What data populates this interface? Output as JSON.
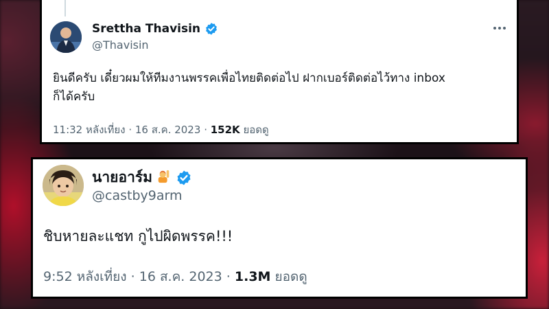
{
  "tweets": [
    {
      "name": "Srettha Thavisin",
      "handle": "@Thavisin",
      "verified": true,
      "text_line1": "ยินดีครับ เดี๋ยวผมให้ทีมงานพรรคเพื่อไทยติดต่อไป ฝากเบอร์ติดต่อไว้ทาง inbox",
      "text_line2": "ก็ได้ครับ",
      "time": "11:32 หลังเที่ยง",
      "date": "16 ส.ค. 2023",
      "views": "152K",
      "views_label": "ยอดดู",
      "separator": "·",
      "icons": {
        "verified": "verified-badge-icon",
        "more": "more-options-icon"
      }
    },
    {
      "name": "นายอาร์ม",
      "emoji": "🙋",
      "handle": "@castby9arm",
      "verified": true,
      "text": "ชิบหายละแชท กูไปผิดพรรค!!!",
      "time": "9:52 หลังเที่ยง",
      "date": "16 ส.ค. 2023",
      "views": "1.3M",
      "views_label": "ยอดดู",
      "separator": "·",
      "icons": {
        "verified": "verified-badge-icon",
        "emoji": "person-raising-hand-icon"
      }
    }
  ],
  "colors": {
    "verified_blue": "#1d9bf0",
    "text_primary": "#0f1419",
    "text_secondary": "#536471",
    "card_border": "#000000",
    "background_red": "#b0102a"
  }
}
